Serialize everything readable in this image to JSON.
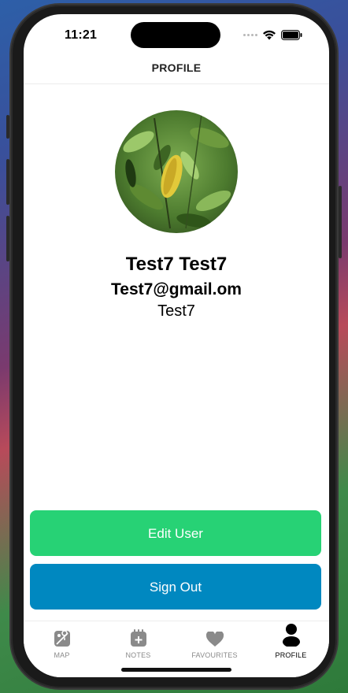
{
  "status_bar": {
    "time": "11:21"
  },
  "header": {
    "title": "PROFILE"
  },
  "profile": {
    "avatar_icon": "leaf-photo",
    "name": "Test7 Test7",
    "email": "Test7@gmail.om",
    "username": "Test7"
  },
  "actions": {
    "edit_label": "Edit User",
    "signout_label": "Sign Out"
  },
  "tabs": [
    {
      "label": "MAP",
      "icon": "map-icon",
      "active": false
    },
    {
      "label": "NOTES",
      "icon": "notes-icon",
      "active": false
    },
    {
      "label": "FAVOURITES",
      "icon": "heart-icon",
      "active": false
    },
    {
      "label": "PROFILE",
      "icon": "person-icon",
      "active": true
    }
  ],
  "colors": {
    "edit_button": "#27d275",
    "signout_button": "#0088c0",
    "tab_inactive": "#8a8a8a",
    "tab_active": "#000000"
  }
}
